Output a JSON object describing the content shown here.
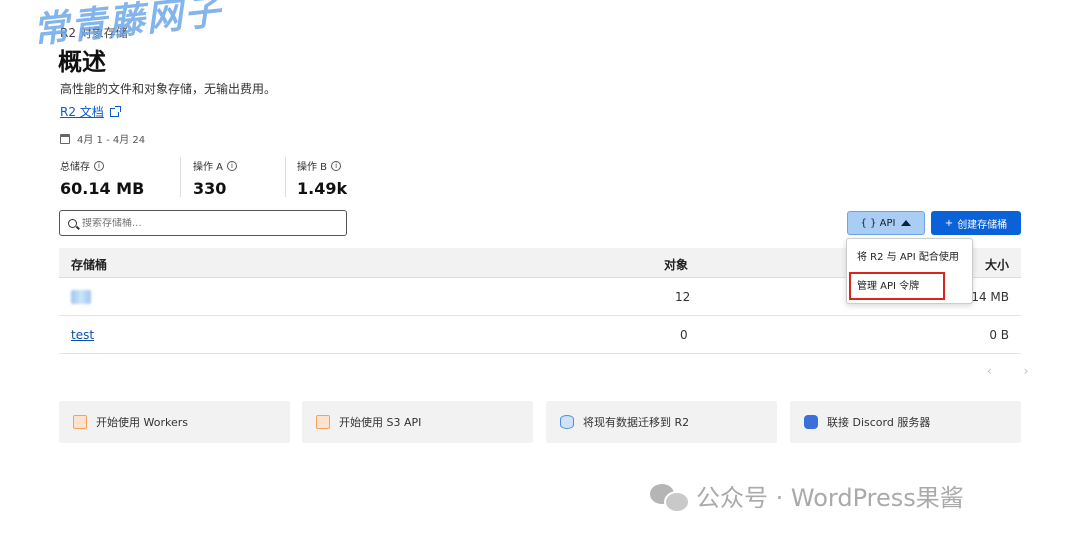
{
  "watermark": "常青藤网子",
  "breadcrumb": "R2 对象存储",
  "page": {
    "title": "概述",
    "subtitle": "高性能的文件和对象存储，无输出费用。",
    "doc_link": "R2 文档",
    "date_range": "4月 1 - 4月 24"
  },
  "stats": [
    {
      "label": "总储存",
      "value": "60.14 MB"
    },
    {
      "label": "操作 A",
      "value": "330"
    },
    {
      "label": "操作 B",
      "value": "1.49k"
    }
  ],
  "search": {
    "placeholder": "搜索存储桶..."
  },
  "toolbar": {
    "api_label": "{ } API",
    "create_label": "创建存储桶",
    "create_icon": "+"
  },
  "dropdown": {
    "items": [
      "将 R2 与 API 配合使用",
      "管理 API 令牌"
    ]
  },
  "table": {
    "headers": [
      "存储桶",
      "对象",
      "大小"
    ],
    "rows": [
      {
        "name": "tgp",
        "objects": "12",
        "size": "14 MB"
      },
      {
        "name": "test",
        "objects": "0",
        "size": "0 B"
      }
    ]
  },
  "pager": "‹ ›",
  "cards": [
    {
      "label": "开始使用 Workers",
      "icon": "workers-icon",
      "color": "#f6a25e"
    },
    {
      "label": "开始使用 S3 API",
      "icon": "s3-icon",
      "color": "#f6a25e"
    },
    {
      "label": "将现有数据迁移到 R2",
      "icon": "database-icon",
      "color": "#4a90e2"
    },
    {
      "label": "联接 Discord 服务器",
      "icon": "discord-icon",
      "color": "#3d6fd8"
    }
  ],
  "wechat_mark": "公众号 · WordPress果酱",
  "colors": {
    "primary": "#0a62d8",
    "highlight": "#d9261c",
    "api_bg": "#a9cdf5"
  }
}
